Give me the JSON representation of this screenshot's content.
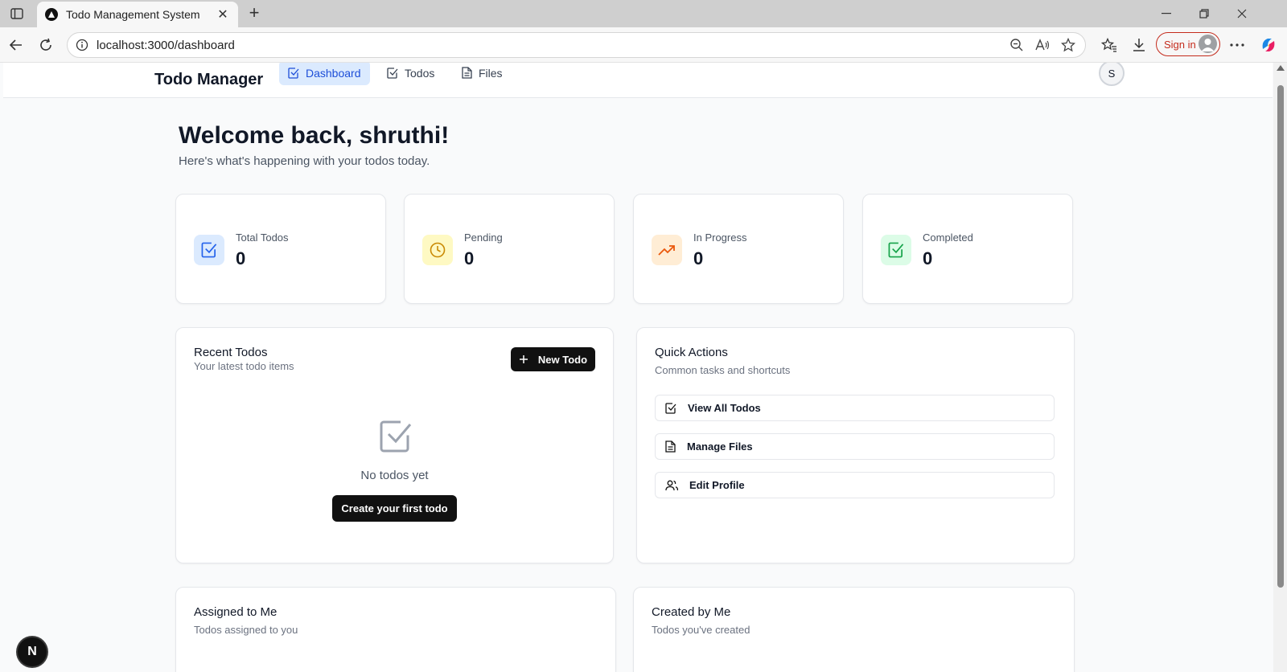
{
  "browser": {
    "tab_title": "Todo Management System",
    "url": "localhost:3000/dashboard",
    "signin_label": "Sign in"
  },
  "header": {
    "brand": "Todo Manager",
    "nav": [
      {
        "label": "Dashboard",
        "icon": "check-square-icon",
        "active": true
      },
      {
        "label": "Todos",
        "icon": "check-square-icon",
        "active": false
      },
      {
        "label": "Files",
        "icon": "file-text-icon",
        "active": false
      }
    ],
    "avatar_initial": "S"
  },
  "welcome": {
    "title": "Welcome back, shruthi!",
    "subtitle": "Here's what's happening with your todos today."
  },
  "stats": [
    {
      "label": "Total Todos",
      "value": "0",
      "icon": "check-square-icon",
      "color": "#2563eb",
      "bg": "#dbeafe"
    },
    {
      "label": "Pending",
      "value": "0",
      "icon": "clock-icon",
      "color": "#ca8a04",
      "bg": "#fef9c3"
    },
    {
      "label": "In Progress",
      "value": "0",
      "icon": "trending-up-icon",
      "color": "#ea580c",
      "bg": "#ffedd5"
    },
    {
      "label": "Completed",
      "value": "0",
      "icon": "check-square-icon",
      "color": "#16a34a",
      "bg": "#dcfce7"
    }
  ],
  "recent": {
    "title": "Recent Todos",
    "subtitle": "Your latest todo items",
    "new_button": "New Todo",
    "empty_text": "No todos yet",
    "create_button": "Create your first todo"
  },
  "quick_actions": {
    "title": "Quick Actions",
    "subtitle": "Common tasks and shortcuts",
    "items": [
      {
        "label": "View All Todos",
        "icon": "check-square-icon"
      },
      {
        "label": "Manage Files",
        "icon": "file-text-icon"
      },
      {
        "label": "Edit Profile",
        "icon": "users-icon"
      }
    ]
  },
  "assigned": {
    "title": "Assigned to Me",
    "subtitle": "Todos assigned to you"
  },
  "created": {
    "title": "Created by Me",
    "subtitle": "Todos you've created"
  },
  "dev_badge": "N"
}
